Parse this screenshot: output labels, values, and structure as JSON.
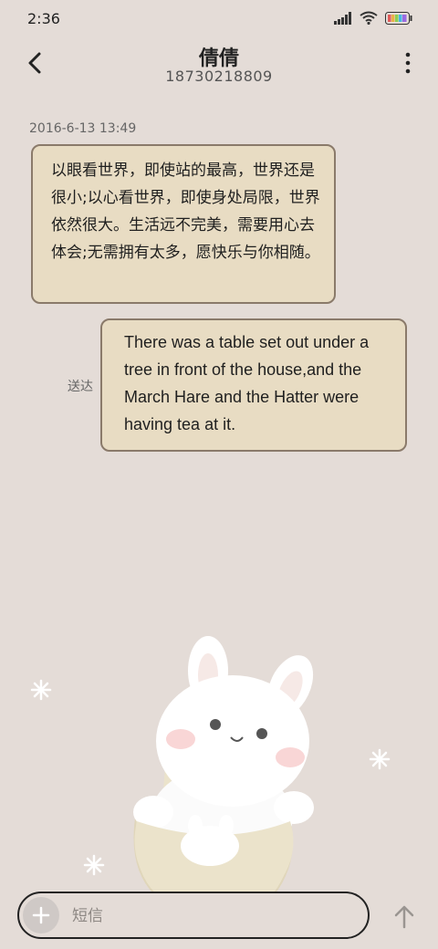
{
  "status_bar": {
    "time": "2:36"
  },
  "header": {
    "contact_name": "倩倩",
    "contact_number": "18730218809"
  },
  "conversation": {
    "timestamp": "2016-6-13 13:49",
    "messages": [
      {
        "direction": "incoming",
        "text": "以眼看世界，即使站的最高，世界还是很小;以心看世界，即使身处局限，世界依然很大。生活远不完美，需要用心去体会;无需拥有太多，愿快乐与你相随。"
      },
      {
        "direction": "outgoing",
        "text": "There was a table set out under a tree in front of the house,and the March Hare and the Hatter were having tea at it.",
        "status": "送达"
      }
    ]
  },
  "composer": {
    "placeholder": "短信"
  },
  "icons": {
    "back": "chevron-left-icon",
    "more": "more-vertical-icon",
    "add": "plus-icon",
    "send": "arrow-up-icon",
    "signal": "signal-icon",
    "wifi": "wifi-icon",
    "battery": "battery-icon"
  },
  "colors": {
    "background": "#e4dcd7",
    "bubble_fill": "#e8dcc3",
    "bubble_border": "#8a7a6a"
  }
}
